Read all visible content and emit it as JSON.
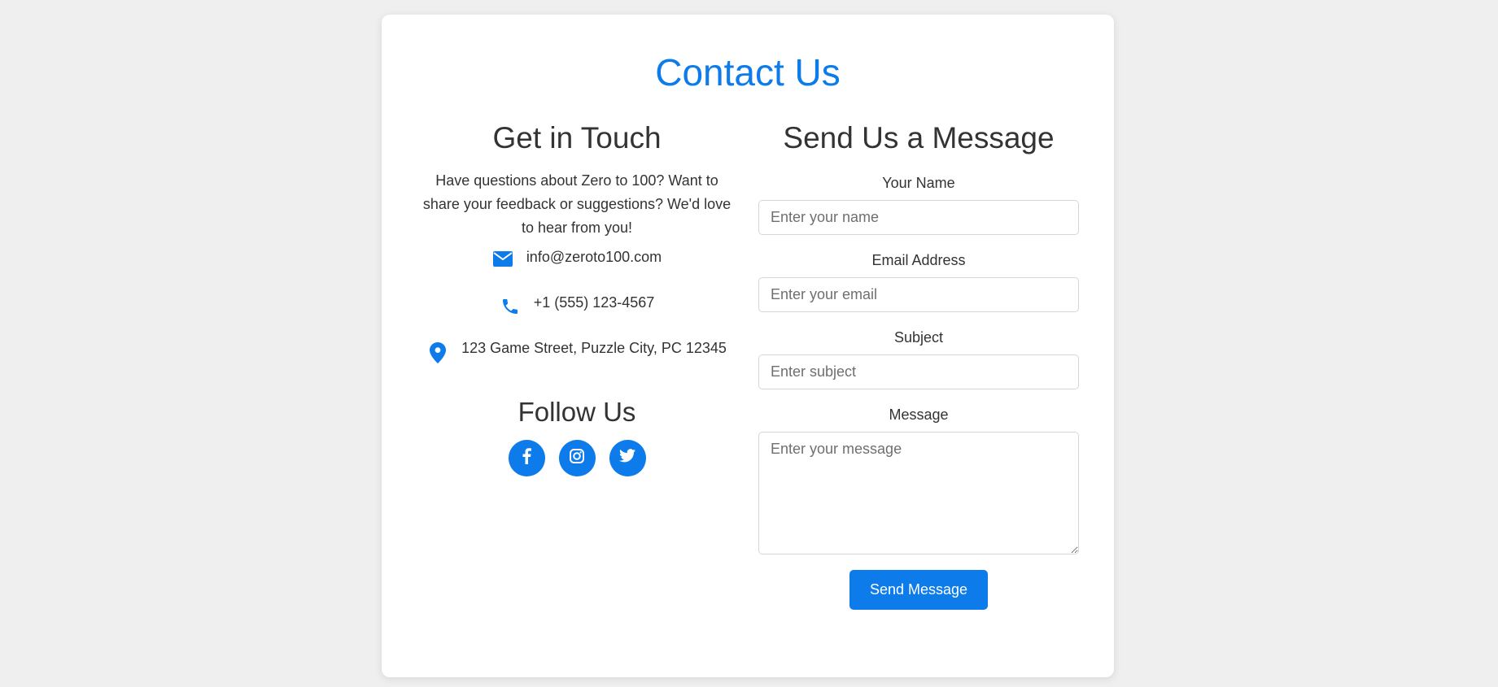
{
  "page": {
    "title": "Contact Us",
    "accent_color": "#0d7bea"
  },
  "info": {
    "heading": "Get in Touch",
    "intro": "Have questions about Zero to 100? Want to share your feedback or suggestions? We'd love to hear from you!",
    "email": {
      "icon": "envelope-icon",
      "text": "info@zeroto100.com"
    },
    "phone": {
      "icon": "phone-icon",
      "text": "+1 (555) 123-4567"
    },
    "address": {
      "icon": "map-pin-icon",
      "text": "123 Game Street, Puzzle City, PC 12345"
    }
  },
  "social": {
    "heading": "Follow Us",
    "links": [
      {
        "icon": "facebook-icon"
      },
      {
        "icon": "instagram-icon"
      },
      {
        "icon": "twitter-icon"
      }
    ]
  },
  "form": {
    "heading": "Send Us a Message",
    "name": {
      "label": "Your Name",
      "placeholder": "Enter your name",
      "value": ""
    },
    "email": {
      "label": "Email Address",
      "placeholder": "Enter your email",
      "value": ""
    },
    "subject": {
      "label": "Subject",
      "placeholder": "Enter subject",
      "value": ""
    },
    "message": {
      "label": "Message",
      "placeholder": "Enter your message",
      "value": ""
    },
    "submit_label": "Send Message"
  }
}
